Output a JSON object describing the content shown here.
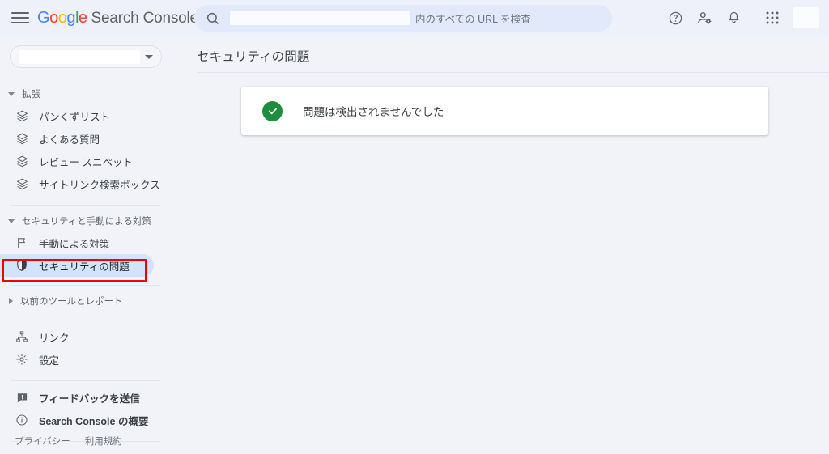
{
  "header": {
    "menu_icon": "hamburger-icon",
    "logo_text": "Google",
    "product_name": "Search Console",
    "search": {
      "icon": "search-icon",
      "value": "",
      "suffix_label": "内のすべての URL を検査",
      "placeholder": "内のすべての URL を検査"
    },
    "actions": [
      {
        "name": "help-icon",
        "label": "ヘルプ"
      },
      {
        "name": "account-settings-icon",
        "label": "アカウント設定"
      },
      {
        "name": "notifications-bell-icon",
        "label": "通知"
      },
      {
        "name": "apps-grid-icon",
        "label": "Google アプリ"
      }
    ],
    "avatar": {
      "name": "avatar",
      "label": ""
    }
  },
  "sidebar": {
    "property_selector": {
      "value": "",
      "caret_icon": "chevron-down-icon"
    },
    "groups": [
      {
        "id": "enhancements",
        "label": "拡張",
        "expanded": true,
        "items": [
          {
            "label": "パンくずリスト",
            "icon": "layers-icon"
          },
          {
            "label": "よくある質問",
            "icon": "layers-icon"
          },
          {
            "label": "レビュー スニペット",
            "icon": "layers-icon"
          },
          {
            "label": "サイトリンク検索ボックス",
            "icon": "layers-icon"
          }
        ]
      },
      {
        "id": "security-manual-actions",
        "label": "セキュリティと手動による対策",
        "expanded": true,
        "items": [
          {
            "label": "手動による対策",
            "icon": "flag-icon",
            "selected": false
          },
          {
            "label": "セキュリティの問題",
            "icon": "shield-icon",
            "selected": true
          }
        ]
      },
      {
        "id": "legacy-tools",
        "label": "以前のツールとレポート",
        "expanded": false,
        "items": []
      }
    ],
    "links_section": [
      {
        "label": "リンク",
        "icon": "links-tree-icon"
      },
      {
        "label": "設定",
        "icon": "gear-icon"
      }
    ],
    "support_section": [
      {
        "label": "フィードバックを送信",
        "icon": "feedback-icon"
      },
      {
        "label": "Search Console の概要",
        "icon": "info-icon"
      }
    ],
    "footer": [
      {
        "label": "プライバシー"
      },
      {
        "label": "利用規約"
      }
    ],
    "highlight": {
      "target": "セキュリティの問題",
      "color": "#f20000"
    }
  },
  "main": {
    "page_title": "セキュリティの問題",
    "status_card": {
      "icon": "check-circle-icon",
      "icon_color": "#1e8e3e",
      "message": "問題は検出されませんでした"
    }
  },
  "colors": {
    "page_background": "#f1f3f9",
    "topbar_background": "#eef1f9",
    "search_background": "#e2e9fb",
    "selected_nav": "#d2e3fc",
    "success_green": "#1e8e3e",
    "highlight_red": "#f20000"
  }
}
